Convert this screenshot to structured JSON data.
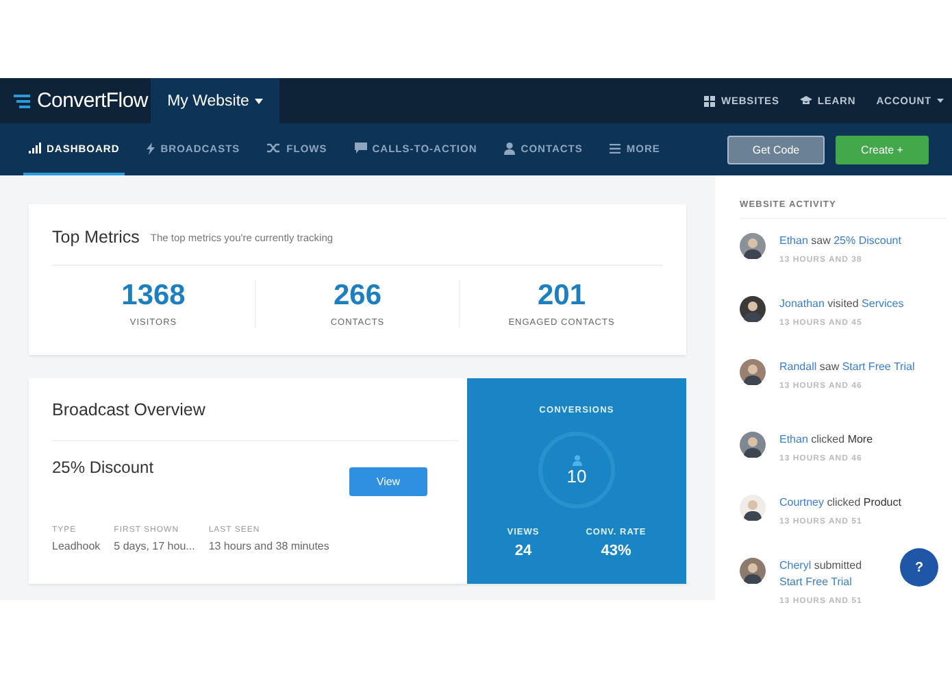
{
  "brand": {
    "name": "ConvertFlow"
  },
  "site_menu": {
    "label": "My Website"
  },
  "top_links": [
    {
      "label": "WEBSITES",
      "dropdown": false
    },
    {
      "label": "LEARN",
      "dropdown": false
    },
    {
      "label": "ACCOUNT",
      "dropdown": true
    }
  ],
  "tabs": [
    {
      "label": "DASHBOARD",
      "selected": true
    },
    {
      "label": "BROADCASTS",
      "selected": false
    },
    {
      "label": "FLOWS",
      "selected": false
    },
    {
      "label": "CALLS-TO-ACTION",
      "selected": false
    },
    {
      "label": "CONTACTS",
      "selected": false
    },
    {
      "label": "MORE",
      "selected": false
    }
  ],
  "buttons": [
    {
      "label": "Get Code",
      "kind": "secondary"
    },
    {
      "label": "Create +",
      "kind": "primary"
    }
  ],
  "top_metrics": {
    "title": "Top Metrics",
    "subtitle": "The top metrics you're currently tracking",
    "metrics": [
      {
        "value": "1368",
        "label": "VISITORS"
      },
      {
        "value": "266",
        "label": "CONTACTS"
      },
      {
        "value": "201",
        "label": "ENGAGED CONTACTS"
      }
    ]
  },
  "broadcast": {
    "title": "Broadcast Overview",
    "name": "25% Discount",
    "view_button": "View",
    "details": [
      {
        "label": "TYPE",
        "value": "Leadhook"
      },
      {
        "label": "FIRST SHOWN",
        "value": "5 days, 17 hou..."
      },
      {
        "label": "LAST SEEN",
        "value": "13 hours and 38 minutes"
      }
    ],
    "conversions": {
      "title": "CONVERSIONS",
      "value": "10",
      "stats": [
        {
          "label": "VIEWS",
          "value": "24"
        },
        {
          "label": "CONV. RATE",
          "value": "43%"
        }
      ]
    }
  },
  "activity": {
    "title": "WEBSITE ACTIVITY",
    "items": [
      {
        "name": "Ethan",
        "verb": "saw",
        "target": "25% Discount",
        "target_linked": true,
        "time": "13 HOURS AND 38"
      },
      {
        "name": "Jonathan",
        "verb": "visited",
        "target": "Services",
        "target_linked": true,
        "time": "13 HOURS AND 45"
      },
      {
        "name": "Randall",
        "verb": "saw",
        "target": "Start Free Trial",
        "target_linked": true,
        "time": "13 HOURS AND 46"
      },
      {
        "name": "Ethan",
        "verb": "clicked",
        "target": "More",
        "target_linked": false,
        "time": "13 HOURS AND 46"
      },
      {
        "name": "Courtney",
        "verb": "clicked",
        "target": "Product",
        "target_linked": false,
        "time": "13 HOURS AND 51"
      },
      {
        "name": "Cheryl",
        "verb": "submitted",
        "target": "Start Free Trial",
        "target_linked": true,
        "time": "13 HOURS AND 51"
      }
    ]
  },
  "help_button": {
    "label": "?"
  }
}
